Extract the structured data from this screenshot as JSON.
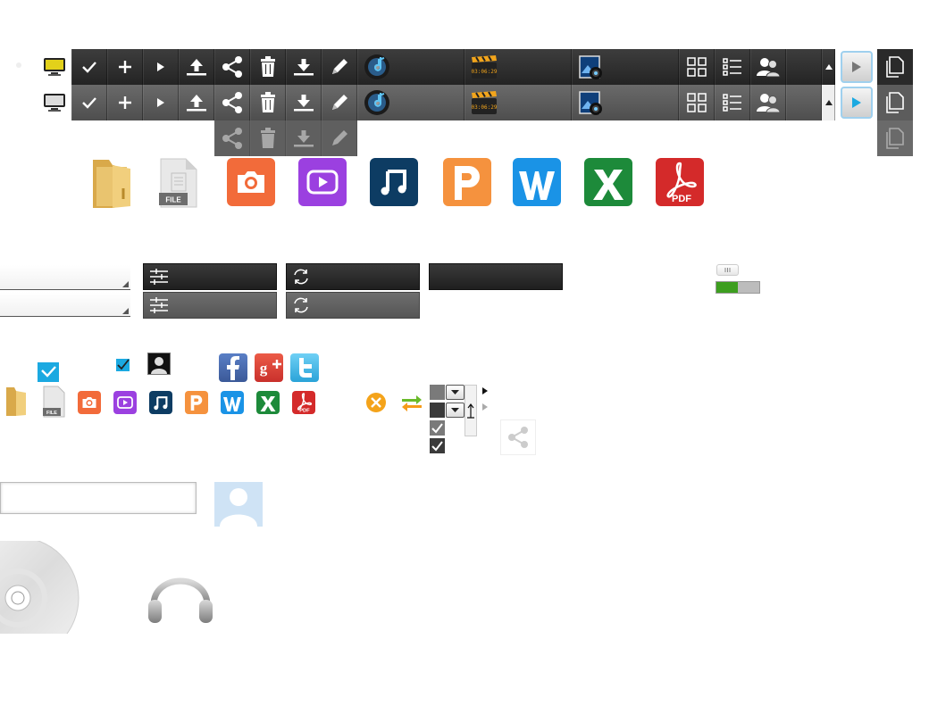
{
  "toolbar": {
    "wide_cells": [
      "music",
      "video",
      "photo"
    ],
    "tool_icons": [
      "check",
      "plus",
      "play",
      "upload",
      "share",
      "trash",
      "download",
      "pencil"
    ]
  },
  "file_icons": [
    "folder",
    "file",
    "camera",
    "video",
    "music",
    "presentation",
    "word",
    "excel",
    "pdf"
  ],
  "file_label": "FILE",
  "pdf_label": "PDF",
  "social": [
    "facebook",
    "google-plus",
    "twitter"
  ],
  "colors": {
    "toolbar_dark": "#2c2c2c",
    "toolbar_mid": "#5c5c5c",
    "camera": "#f26b3a",
    "video": "#9b40e0",
    "music": "#0d3c63",
    "presentation": "#f5923e",
    "word": "#1a93e6",
    "excel": "#1d8a3a",
    "pdf": "#d42a2a",
    "toggle_green": "#3d9e1f",
    "accent_blue": "#1ba9e1"
  },
  "toggle": {
    "on_fraction": 0.5
  },
  "text_input": {
    "value": ""
  }
}
